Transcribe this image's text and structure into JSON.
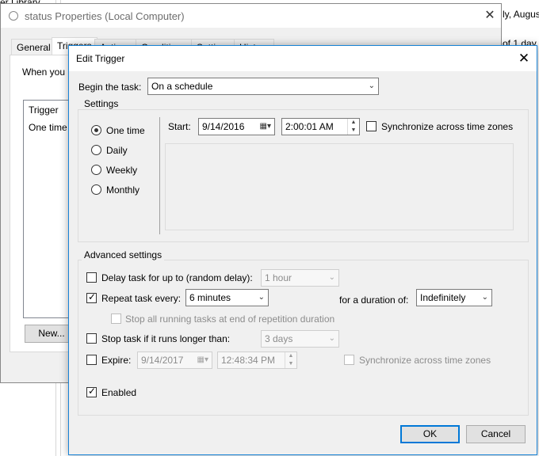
{
  "background": {
    "top_left_fragment": "er Library",
    "right_fragments": [
      "ly, Augus",
      "of 1 day"
    ]
  },
  "properties_window": {
    "title": "status Properties (Local Computer)",
    "close_glyph": "✕",
    "tabs": [
      "General",
      "Triggers",
      "Actions",
      "Conditions",
      "Settings",
      "History"
    ],
    "intro_text": "When you",
    "list_header": "Trigger",
    "list_first_row": "One time",
    "new_button": "New..."
  },
  "dialog": {
    "title": "Edit Trigger",
    "close_glyph": "✕",
    "begin_label": "Begin the task:",
    "begin_value": "On a schedule",
    "settings_group": "Settings",
    "schedule_options": [
      {
        "label": "One time",
        "selected": true
      },
      {
        "label": "Daily",
        "selected": false
      },
      {
        "label": "Weekly",
        "selected": false
      },
      {
        "label": "Monthly",
        "selected": false
      }
    ],
    "start_label": "Start:",
    "start_date": "9/14/2016",
    "start_time": "2:00:01 AM",
    "sync_label": "Synchronize across time zones",
    "advanced_group": "Advanced settings",
    "delay_label": "Delay task for up to (random delay):",
    "delay_value": "1 hour",
    "repeat_label": "Repeat task every:",
    "repeat_value": "6 minutes",
    "duration_label": "for a duration of:",
    "duration_value": "Indefinitely",
    "stop_all_label": "Stop all running tasks at end of repetition duration",
    "stop_longer_label": "Stop task if it runs longer than:",
    "stop_longer_value": "3 days",
    "expire_label": "Expire:",
    "expire_date": "9/14/2017",
    "expire_time": "12:48:34 PM",
    "expire_sync_label": "Synchronize across time zones",
    "enabled_label": "Enabled",
    "ok_button": "OK",
    "cancel_button": "Cancel"
  }
}
